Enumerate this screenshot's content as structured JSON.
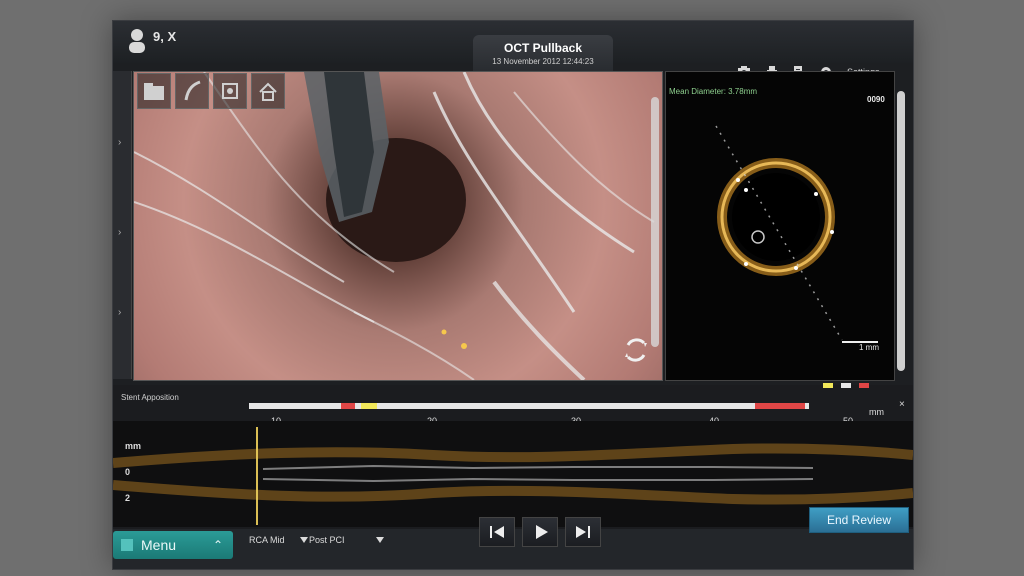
{
  "patient": {
    "name": "9, X"
  },
  "header": {
    "title": "OCT Pullback",
    "datetime": "13 November 2012 12:44:23",
    "settings_label": "Settings"
  },
  "cross_section": {
    "mean_diameter": "Mean Diameter: 3.78mm",
    "frame": "0090",
    "scale": "1 mm"
  },
  "stent": {
    "label": "Stent Apposition"
  },
  "longitudinal": {
    "ticks": [
      "10",
      "20",
      "30",
      "40",
      "50"
    ],
    "unit": "mm",
    "y_labels": {
      "mm": "mm",
      "zero": "0",
      "two": "2"
    }
  },
  "bottom": {
    "menu": "Menu",
    "vessel": "RCA Mid",
    "procedure": "Post PCI",
    "end_review": "End Review"
  },
  "colors": {
    "accent_teal": "#2b9b97",
    "end_review_blue": "#3f9ec4"
  }
}
